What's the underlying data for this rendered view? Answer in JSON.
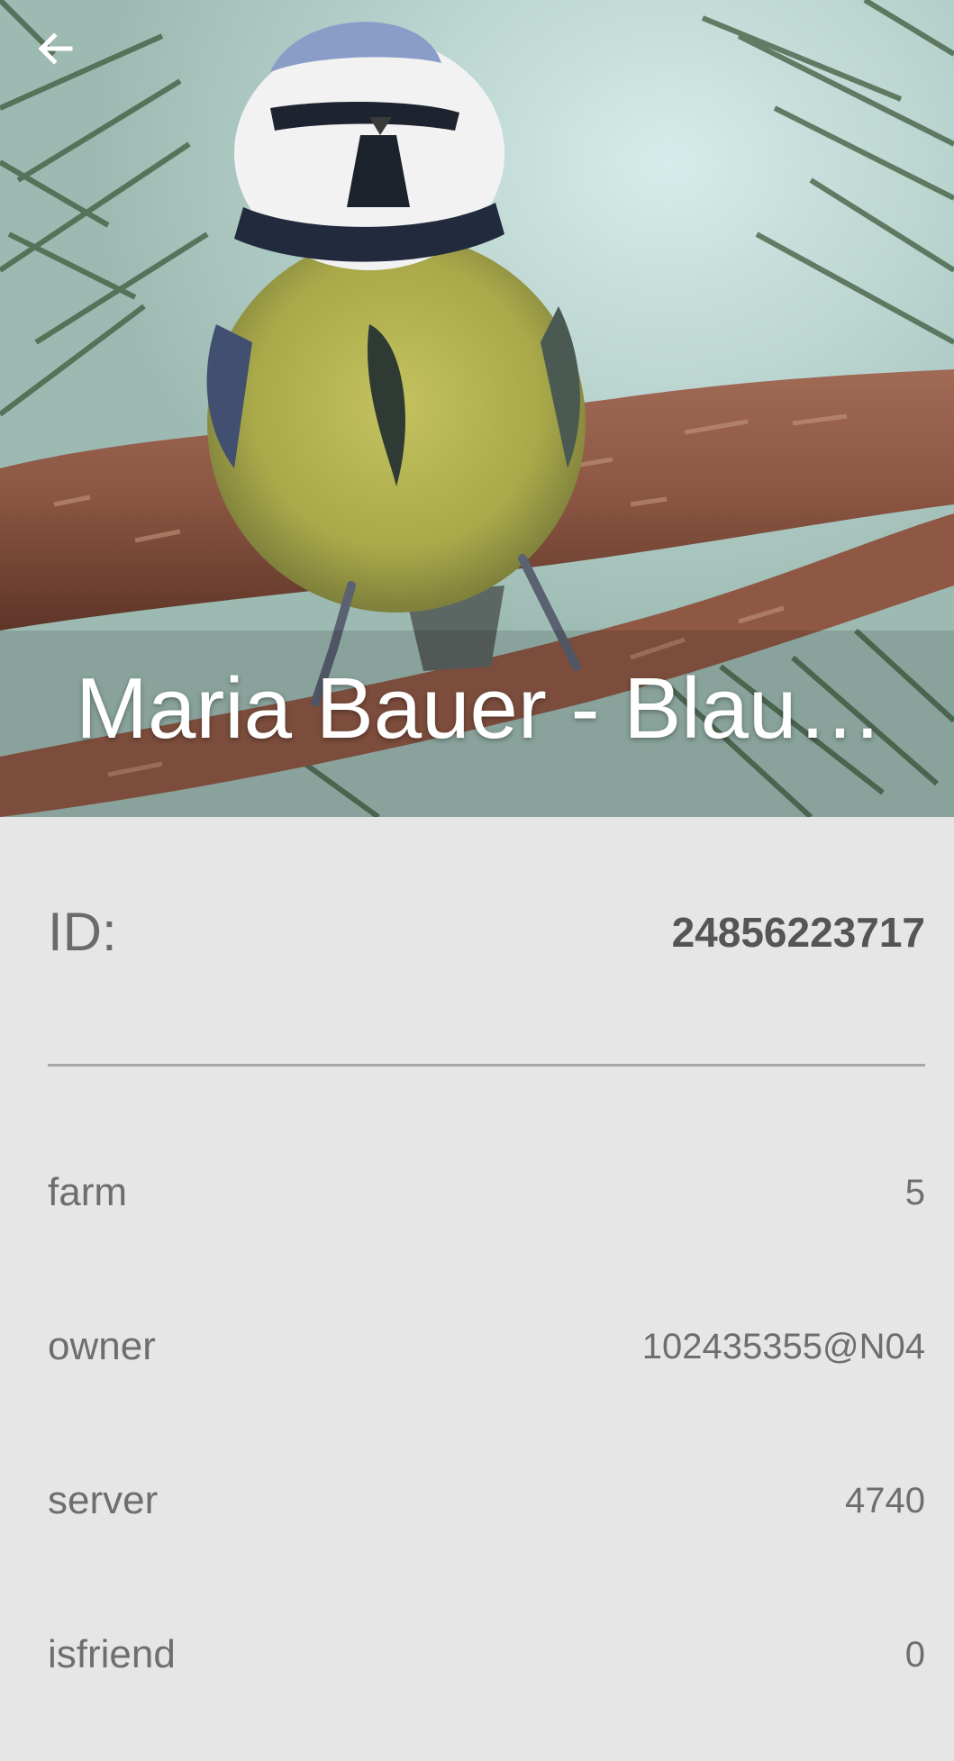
{
  "header": {
    "title": "Maria Bauer - Blau…",
    "back_icon": "arrow-left-icon",
    "photo_subject": "blue-tit-on-branch"
  },
  "id_row": {
    "label": "ID:",
    "value": "24856223717"
  },
  "properties": [
    {
      "label": "farm",
      "value": "5"
    },
    {
      "label": "owner",
      "value": "102435355@N04"
    },
    {
      "label": "server",
      "value": "4740"
    },
    {
      "label": "isfriend",
      "value": "0"
    }
  ],
  "colors": {
    "background": "#e6e6e6",
    "title_text": "#ffffff",
    "label_text": "#6e6e6e",
    "divider": "#a6a6a6"
  }
}
